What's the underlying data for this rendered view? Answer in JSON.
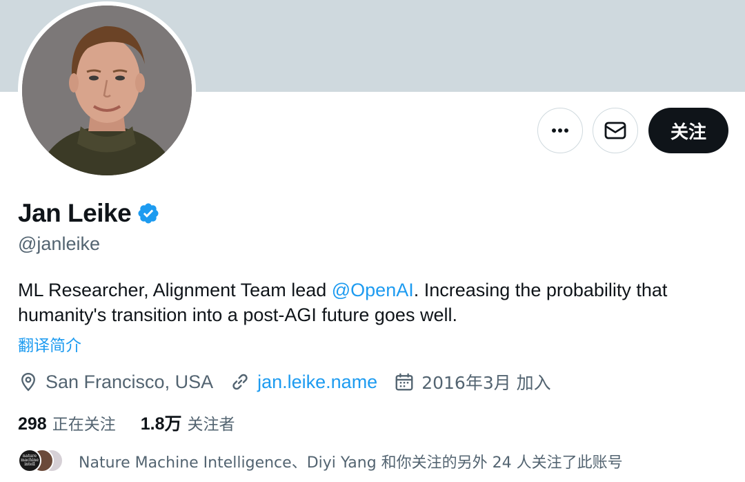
{
  "profile": {
    "name": "Jan Leike",
    "handle": "@janleike",
    "bio_before": "ML Researcher, Alignment Team lead ",
    "bio_mention": "@OpenAI",
    "bio_after": ". Increasing the probability that humanity's transition into a post-AGI future goes well.",
    "translate_label": "翻译简介",
    "location": "San Francisco, USA",
    "website": "jan.leike.name",
    "joined": "2016年3月 加入"
  },
  "actions": {
    "follow_label": "关注"
  },
  "stats": {
    "following_count": "298",
    "following_label": "正在关注",
    "followers_count": "1.8万",
    "followers_label": "关注者"
  },
  "followers_you_know": {
    "text": "Nature Machine Intelligence、Diyi Yang 和你关注的另外 24 人关注了此账号",
    "avatar_a_label": "nature machine intell"
  },
  "icons": {
    "more": "more-icon",
    "message": "envelope-icon",
    "verified": "verified-badge-icon",
    "location": "location-pin-icon",
    "link": "link-icon",
    "calendar": "calendar-icon"
  },
  "colors": {
    "banner": "#cfd9de",
    "accent": "#1d9bf0",
    "text_primary": "#0f1419",
    "text_secondary": "#536471",
    "follow_button": "#0f1419"
  }
}
